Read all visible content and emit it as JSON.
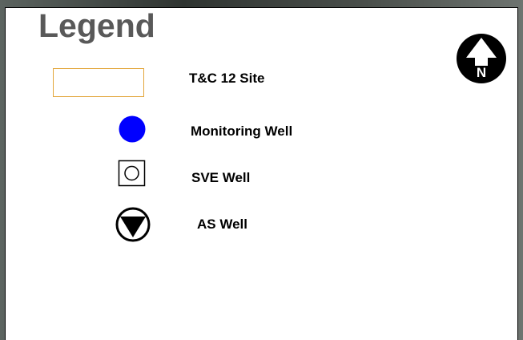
{
  "legend": {
    "title": "Legend",
    "items": [
      {
        "label": "T&C 12 Site",
        "symbol": "site-boundary-rectangle",
        "color": "#e3a63b"
      },
      {
        "label": "Monitoring Well",
        "symbol": "filled-circle",
        "color": "#0000ff"
      },
      {
        "label": "SVE Well",
        "symbol": "circle-in-square",
        "color": "#000000"
      },
      {
        "label": "AS Well",
        "symbol": "triangle-in-circle",
        "color": "#000000"
      }
    ],
    "north_arrow": {
      "letter": "N",
      "icon": "north-arrow-icon"
    }
  }
}
